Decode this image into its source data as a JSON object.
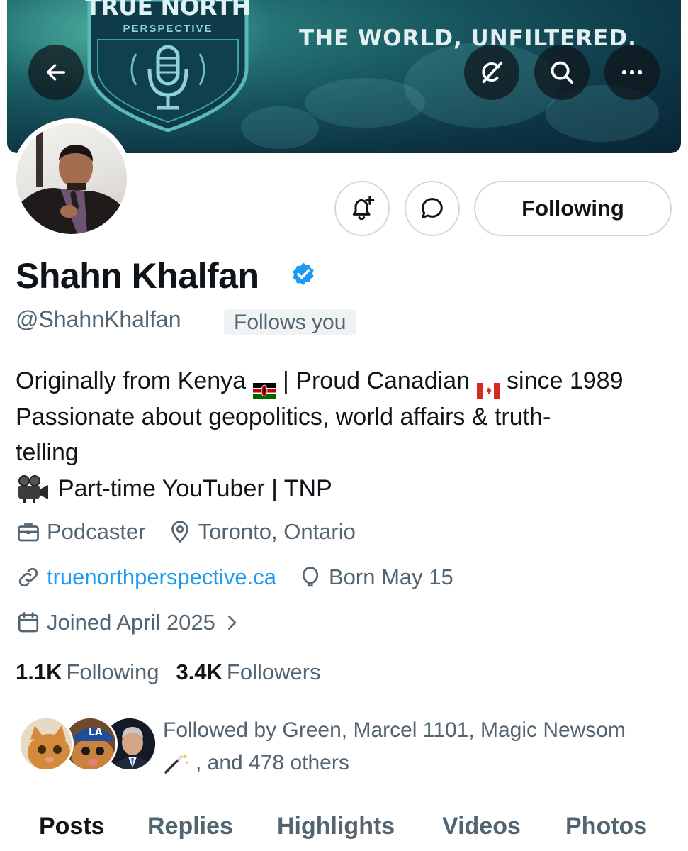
{
  "banner": {
    "brand_title": "TRUE NORTH",
    "brand_subtitle": "PERSPECTIVE",
    "tagline": "THE WORLD, UNFILTERED."
  },
  "nav": {
    "back_icon": "arrow-left-icon",
    "grok_icon": "grok-icon",
    "search_icon": "search-icon",
    "more_icon": "more-icon"
  },
  "actions": {
    "notify_icon": "bell-plus-icon",
    "message_icon": "chat-bubble-icon",
    "follow_label": "Following"
  },
  "profile": {
    "name": "Shahn Khalfan",
    "handle": "@ShahnKhalfan",
    "follows_you": "Follows you",
    "bio": {
      "line1_a": "Originally from Kenya",
      "line1_b": "| Proud Canadian",
      "line1_c": "since 1989",
      "line2": "Passionate about geopolitics, world affairs & truth-",
      "line3": "telling",
      "line4": "Part-time YouTuber | TNP"
    },
    "category": "Podcaster",
    "location": "Toronto, Ontario",
    "website": "truenorthperspective.ca",
    "birthday": "Born May 15",
    "joined": "Joined April 2025"
  },
  "stats": {
    "following_count": "1.1K",
    "following_label": "Following",
    "followers_count": "3.4K",
    "followers_label": "Followers"
  },
  "followed_by": {
    "line1": "Followed by Green, Marcel 1101, Magic Newsom",
    "line2": ", and 478 others"
  },
  "tabs": [
    {
      "label": "Posts",
      "active": true
    },
    {
      "label": "Replies",
      "active": false
    },
    {
      "label": "Highlights",
      "active": false
    },
    {
      "label": "Videos",
      "active": false
    },
    {
      "label": "Photos",
      "active": false
    }
  ],
  "colors": {
    "text_primary": "#0f1419",
    "text_secondary": "#536471",
    "link": "#1d9bf0",
    "verified": "#1d9bf0",
    "border": "#cfd9de"
  }
}
